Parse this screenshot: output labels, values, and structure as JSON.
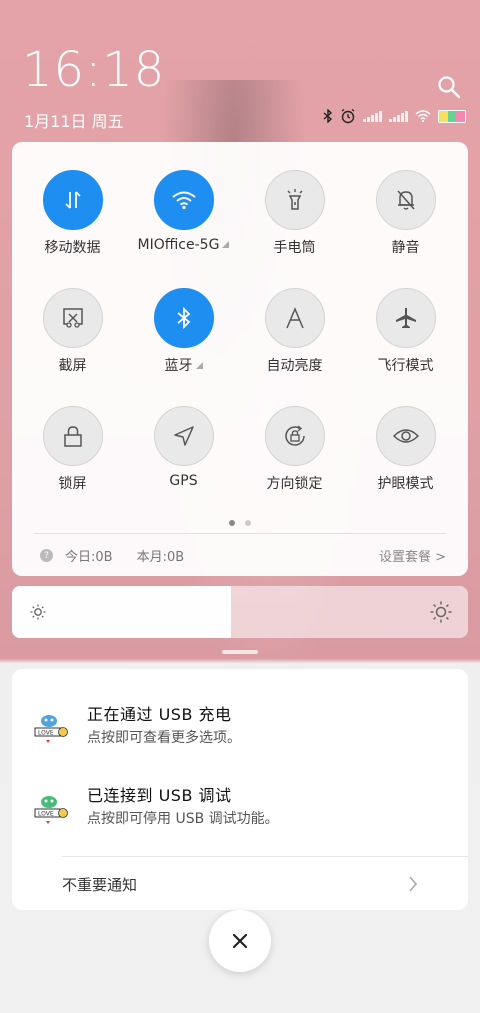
{
  "status": {
    "time": "16:18",
    "date": "1月11日 周五"
  },
  "colors": {
    "accent_on": "#1e8ef0",
    "tile_off": "#e9e9e9",
    "wallpaper": "#e4a3a8"
  },
  "quick_settings": {
    "tiles": [
      {
        "label": "移动数据",
        "icon": "mobile-data-icon",
        "on": true
      },
      {
        "label": "MIOffice-5G",
        "icon": "wifi-icon",
        "on": true,
        "has_menu": true
      },
      {
        "label": "手电筒",
        "icon": "flashlight-icon",
        "on": false
      },
      {
        "label": "静音",
        "icon": "mute-bell-icon",
        "on": false
      },
      {
        "label": "截屏",
        "icon": "screenshot-icon",
        "on": false
      },
      {
        "label": "蓝牙",
        "icon": "bluetooth-icon",
        "on": true,
        "has_menu": true
      },
      {
        "label": "自动亮度",
        "icon": "auto-brightness-icon",
        "on": false
      },
      {
        "label": "飞行模式",
        "icon": "airplane-icon",
        "on": false
      },
      {
        "label": "锁屏",
        "icon": "lock-icon",
        "on": false
      },
      {
        "label": "GPS",
        "icon": "gps-icon",
        "on": false
      },
      {
        "label": "方向锁定",
        "icon": "rotation-lock-icon",
        "on": false
      },
      {
        "label": "护眼模式",
        "icon": "eye-icon",
        "on": false
      }
    ],
    "page_count": 2,
    "current_page": 1,
    "data_usage": {
      "today": "今日:0B",
      "month": "本月:0B",
      "settings_link": "设置套餐 >"
    }
  },
  "brightness": {
    "level": 0.48
  },
  "notifications": [
    {
      "title": "正在通过 USB 充电",
      "subtitle": "点按即可查看更多选项。",
      "icon": "usb-charge-app-icon"
    },
    {
      "title": "已连接到 USB 调试",
      "subtitle": "点按即可停用 USB 调试功能。",
      "icon": "usb-debug-app-icon"
    }
  ],
  "unimportant_label": "不重要通知"
}
